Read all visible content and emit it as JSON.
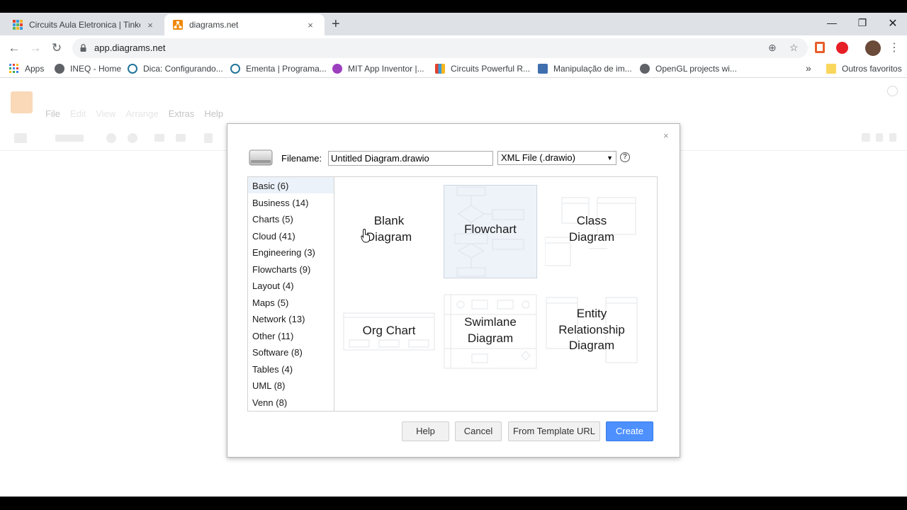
{
  "browser": {
    "tabs": [
      {
        "title": "Circuits Aula Eletronica | Tinkerca",
        "favicon": "tinkercad-favicon-icon",
        "active": false
      },
      {
        "title": "diagrams.net",
        "favicon": "drawio-favicon-icon",
        "active": true
      }
    ],
    "close_symbol": "×",
    "new_tab_symbol": "+",
    "url": "app.diagrams.net",
    "bookmarks": [
      {
        "label": "Apps",
        "icon": "apps-grid-icon"
      },
      {
        "label": "INEQ - Home",
        "icon": "globe-icon"
      },
      {
        "label": "Dica: Configurando...",
        "icon": "wordpress-icon"
      },
      {
        "label": "Ementa | Programa...",
        "icon": "wordpress-icon"
      },
      {
        "label": "MIT App Inventor |...",
        "icon": "app-inventor-icon"
      },
      {
        "label": "Circuits Powerful R...",
        "icon": "tinkercad-icon"
      },
      {
        "label": "Manipulação de im...",
        "icon": "image-site-icon"
      },
      {
        "label": "OpenGL projects wi...",
        "icon": "globe-icon"
      }
    ],
    "bookmarks_overflow": "»",
    "other_bookmarks": "Outros favoritos"
  },
  "app": {
    "menu": [
      "File",
      "Edit",
      "View",
      "Arrange",
      "Extras",
      "Help"
    ]
  },
  "dialog": {
    "close_symbol": "×",
    "filename_label": "Filename:",
    "filename_value": "Untitled Diagram.drawio",
    "format_value": "XML File (.drawio)",
    "format_arrow": "▼",
    "help_symbol": "?",
    "categories": [
      {
        "label": "Basic (6)",
        "selected": true
      },
      {
        "label": "Business (14)"
      },
      {
        "label": "Charts (5)"
      },
      {
        "label": "Cloud (41)"
      },
      {
        "label": "Engineering (3)"
      },
      {
        "label": "Flowcharts (9)"
      },
      {
        "label": "Layout (4)"
      },
      {
        "label": "Maps (5)"
      },
      {
        "label": "Network (13)"
      },
      {
        "label": "Other (11)"
      },
      {
        "label": "Software (8)"
      },
      {
        "label": "Tables (4)"
      },
      {
        "label": "UML (8)"
      },
      {
        "label": "Venn (8)"
      }
    ],
    "templates": [
      {
        "line1": "Blank",
        "line2": "Diagram",
        "line3": ""
      },
      {
        "line1": "Flowchart",
        "line2": "",
        "line3": "",
        "selected": true
      },
      {
        "line1": "Class",
        "line2": "Diagram",
        "line3": ""
      },
      {
        "line1": "Org Chart",
        "line2": "",
        "line3": ""
      },
      {
        "line1": "Swimlane",
        "line2": "Diagram",
        "line3": ""
      },
      {
        "line1": "Entity",
        "line2": "Relationship",
        "line3": "Diagram"
      }
    ],
    "buttons": {
      "help": "Help",
      "cancel": "Cancel",
      "from_url": "From Template URL",
      "create": "Create"
    }
  }
}
